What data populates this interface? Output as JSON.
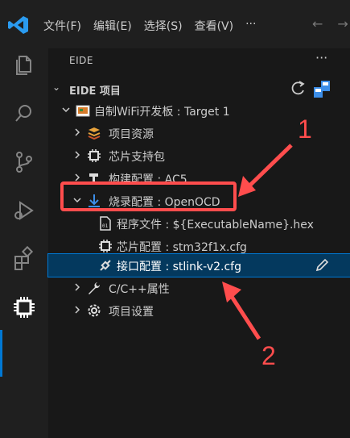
{
  "menu": [
    "文件(F)",
    "编辑(E)",
    "选择(S)",
    "查看(V)",
    "···"
  ],
  "sidebar": {
    "title": "EIDE",
    "more": "···",
    "section": "EIDE 项目"
  },
  "tree": {
    "project": "自制WiFi开发板 : Target 1",
    "resources": "项目资源",
    "chip_pack": "芯片支持包",
    "build_config": "构建配置 : AC5",
    "flash_config": "烧录配置 : OpenOCD",
    "program_file": "程序文件 : ${ExecutableName}.hex",
    "chip_config": "芯片配置 : stm32f1x.cfg",
    "interface_config": "接口配置 : stlink-v2.cfg",
    "cpp_props": "C/C++属性",
    "project_settings": "项目设置"
  },
  "annotations": [
    "1",
    "2"
  ],
  "colors": {
    "accent": "#0078d4",
    "selection": "#04395e",
    "annotation": "#ff4d4d"
  }
}
